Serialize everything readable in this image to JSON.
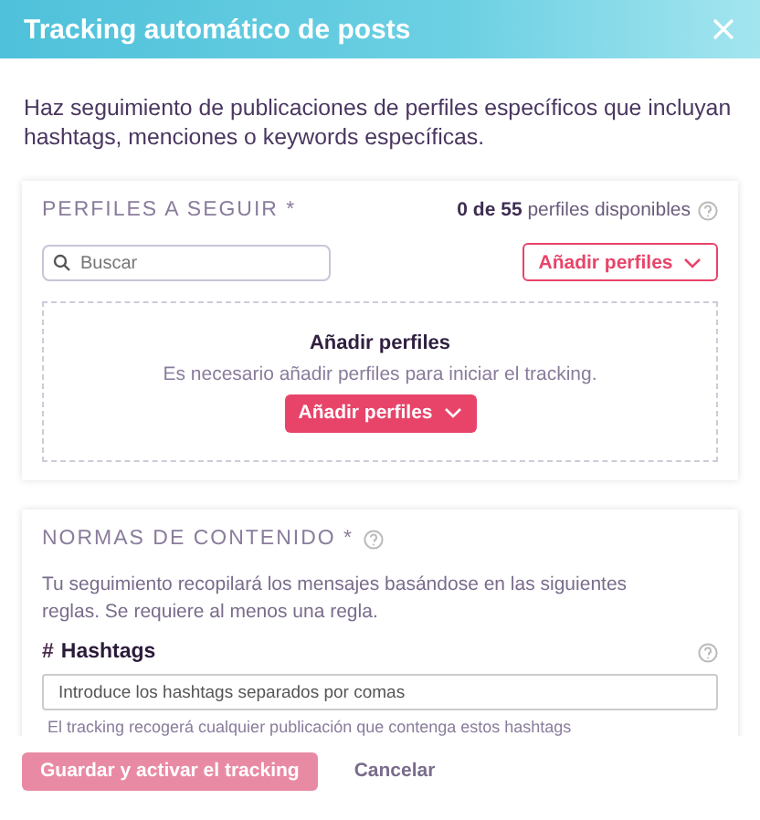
{
  "window": {
    "title": "Tracking automático de posts"
  },
  "intro": "Haz seguimiento de publicaciones de perfiles específicos que incluyan hashtags, menciones o keywords específicas.",
  "profiles": {
    "heading": "PERFILES A SEGUIR *",
    "available": "**0 de 55** perfiles disponibles",
    "search": {
      "placeholder": "Buscar"
    },
    "add_button": "Añadir perfiles",
    "empty": {
      "title": "Añadir perfiles",
      "message": "Es necesario añadir perfiles para iniciar el tracking.",
      "button": "Añadir perfiles"
    }
  },
  "rules": {
    "heading": "NORMAS DE CONTENIDO *",
    "description": "Tu seguimiento recopilará los mensajes basándose en las siguientes reglas. Se requiere al menos una regla.",
    "hashtags": {
      "symbol": "#",
      "label": "Hashtags",
      "placeholder": "Introduce los hashtags separados por comas",
      "hint": "El tracking recogerá cualquier publicación que contenga estos hashtags"
    }
  },
  "footer": {
    "save": {
      "label": "Guardar y activar el tracking",
      "disabled": true
    },
    "cancel": "Cancelar"
  }
}
